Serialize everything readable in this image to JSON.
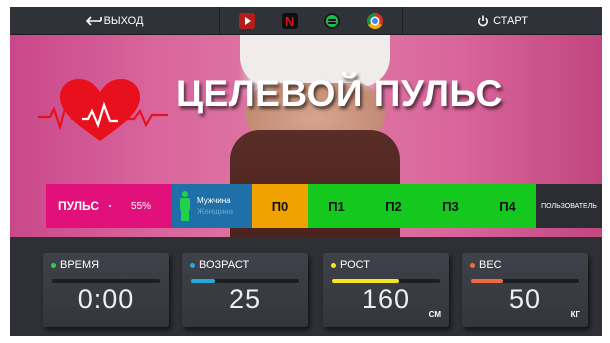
{
  "topbar": {
    "exit_label": "ВЫХОД",
    "start_label": "СТАРТ",
    "apps": [
      {
        "icon": "youtube-icon"
      },
      {
        "icon": "netflix-icon",
        "text": "N"
      },
      {
        "icon": "spotify-icon"
      },
      {
        "icon": "chrome-icon"
      }
    ]
  },
  "hero": {
    "title": "ЦЕЛЕВОЙ ПУЛЬС",
    "accent_color": "#e8101c"
  },
  "bpm_bar": {
    "pulse_label": "ПУЛЬС",
    "pulse_value": "55%",
    "gender_male": "Мужчина",
    "gender_female": "Женщина",
    "zones": [
      "П0",
      "П1",
      "П2",
      "П3",
      "П4"
    ],
    "user_label": "ПОЛЬЗОВАТЕЛЬ",
    "colors": {
      "pulse": "#e2107a",
      "gender": "#1f6fa8",
      "p0": "#f0a300",
      "zones": "#14c81e"
    }
  },
  "panels": [
    {
      "label": "ВРЕМЯ",
      "value": "0:00",
      "unit": "",
      "dot_color": "#2bd14c",
      "fill_color": "#2bd14c",
      "fill_fraction": 0.0
    },
    {
      "label": "ВОЗРАСТ",
      "value": "25",
      "unit": "",
      "dot_color": "#27a9e0",
      "fill_color": "#27a9e0",
      "fill_fraction": 0.22
    },
    {
      "label": "РОСТ",
      "value": "160",
      "unit": "СМ",
      "dot_color": "#f5e51b",
      "fill_color": "#f5e51b",
      "fill_fraction": 0.62
    },
    {
      "label": "ВЕС",
      "value": "50",
      "unit": "КГ",
      "dot_color": "#f06a3c",
      "fill_color": "#f06a3c",
      "fill_fraction": 0.3
    }
  ]
}
